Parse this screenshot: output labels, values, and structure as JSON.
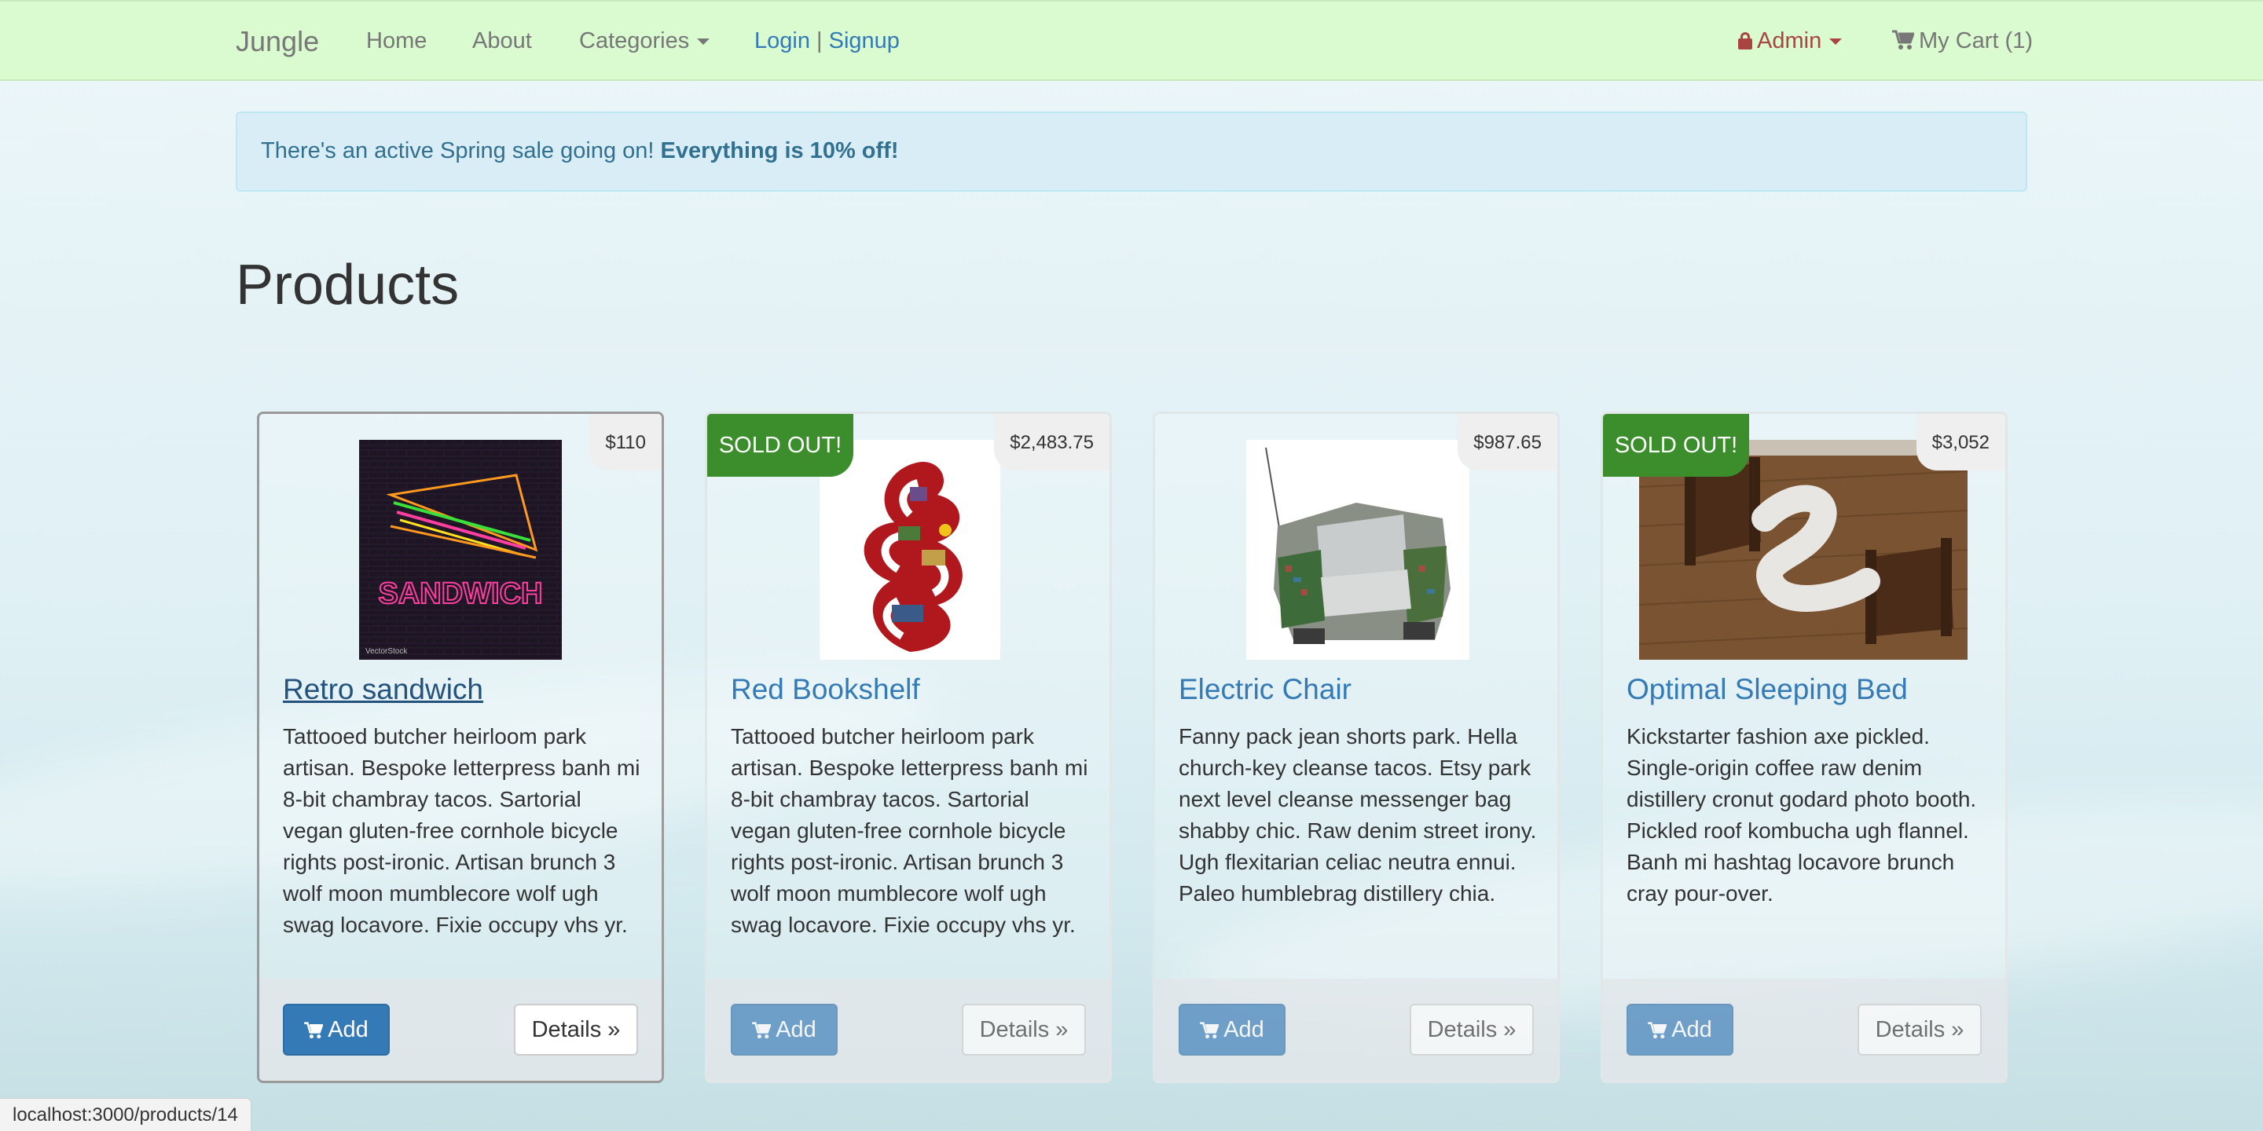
{
  "navbar": {
    "brand": "Jungle",
    "links": [
      "Home",
      "About"
    ],
    "categories_label": "Categories",
    "login_label": "Login",
    "login_separator": "|",
    "signup_label": "Signup",
    "admin_label": "Admin",
    "cart_label": "My Cart (1)"
  },
  "alert": {
    "text": "There's an active Spring sale going on!",
    "emphasis": "Everything is 10% off!"
  },
  "page_title": "Products",
  "products": [
    {
      "name": "Retro sandwich",
      "price": "$110",
      "sold_out": "",
      "description": "Tattooed butcher heirloom park artisan. Bespoke letterpress banh mi 8-bit chambray tacos. Sartorial vegan gluten-free cornhole bicycle rights post-ironic. Artisan brunch 3 wolf moon mumblecore wolf ugh swag locavore. Fixie occupy vhs yr.",
      "add_label": "Add",
      "details_label": "Details »",
      "image_text": "SANDWICH",
      "image_watermark": "VectorStock"
    },
    {
      "name": "Red Bookshelf",
      "price": "$2,483.75",
      "sold_out": "SOLD OUT!",
      "description": "Tattooed butcher heirloom park artisan. Bespoke letterpress banh mi 8-bit chambray tacos. Sartorial vegan gluten-free cornhole bicycle rights post-ironic. Artisan brunch 3 wolf moon mumblecore wolf ugh swag locavore. Fixie occupy vhs yr.",
      "add_label": "Add",
      "details_label": "Details »"
    },
    {
      "name": "Electric Chair",
      "price": "$987.65",
      "sold_out": "",
      "description": "Fanny pack jean shorts park. Hella church-key cleanse tacos. Etsy park next level cleanse messenger bag shabby chic. Raw denim street irony. Ugh flexitarian celiac neutra ennui. Paleo humblebrag distillery chia.",
      "add_label": "Add",
      "details_label": "Details »"
    },
    {
      "name": "Optimal Sleeping Bed",
      "price": "$3,052",
      "sold_out": "SOLD OUT!",
      "description": "Kickstarter fashion axe pickled. Single-origin coffee raw denim distillery cronut godard photo booth. Pickled roof kombucha ugh flannel. Banh mi hashtag locavore brunch cray pour-over.",
      "add_label": "Add",
      "details_label": "Details »"
    }
  ],
  "status_bar": "localhost:3000/products/14"
}
